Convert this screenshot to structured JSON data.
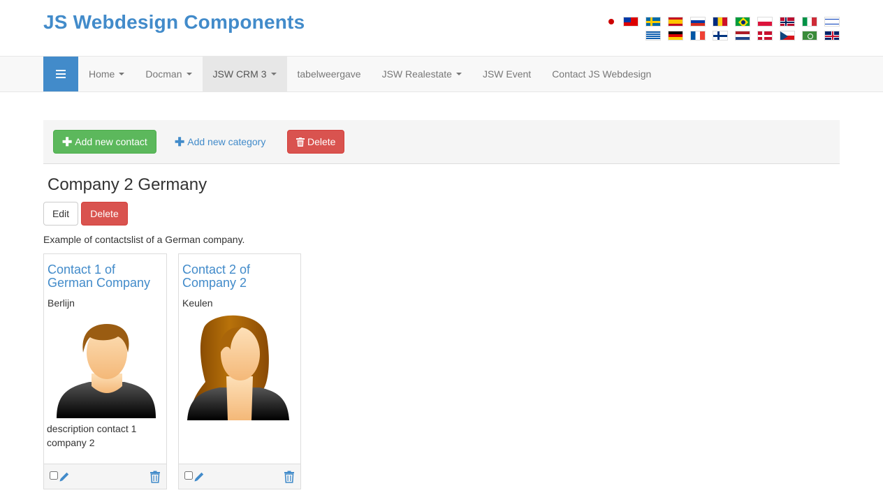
{
  "site": {
    "title": "JS Webdesign Components"
  },
  "nav": {
    "toggle_icon": "hamburger-icon",
    "items": [
      {
        "label": "Home",
        "dropdown": true
      },
      {
        "label": "Docman",
        "dropdown": true
      },
      {
        "label": "JSW CRM 3",
        "dropdown": true,
        "active": true
      },
      {
        "label": "tabelweergave",
        "dropdown": false
      },
      {
        "label": "JSW Realestate",
        "dropdown": true
      },
      {
        "label": "JSW Event",
        "dropdown": false
      },
      {
        "label": "Contact JS Webdesign",
        "dropdown": false
      }
    ]
  },
  "toolbar": {
    "add_contact_label": "Add new contact",
    "add_category_label": "Add new category",
    "delete_label": "Delete"
  },
  "category": {
    "title": "Company 2 Germany",
    "edit_label": "Edit",
    "delete_label": "Delete",
    "description": "Example of contactslist of a German company."
  },
  "contacts": [
    {
      "name": "Contact 1 of German Company",
      "city": "Berlijn",
      "description": "description contact 1 company 2",
      "avatar": "male-avatar"
    },
    {
      "name": "Contact 2 of Company 2",
      "city": "Keulen",
      "description": "",
      "avatar": "female-avatar"
    }
  ],
  "colors": {
    "primary": "#428bca",
    "success": "#5cb85c",
    "danger": "#d9534f",
    "navbar": "#f8f8f8"
  }
}
